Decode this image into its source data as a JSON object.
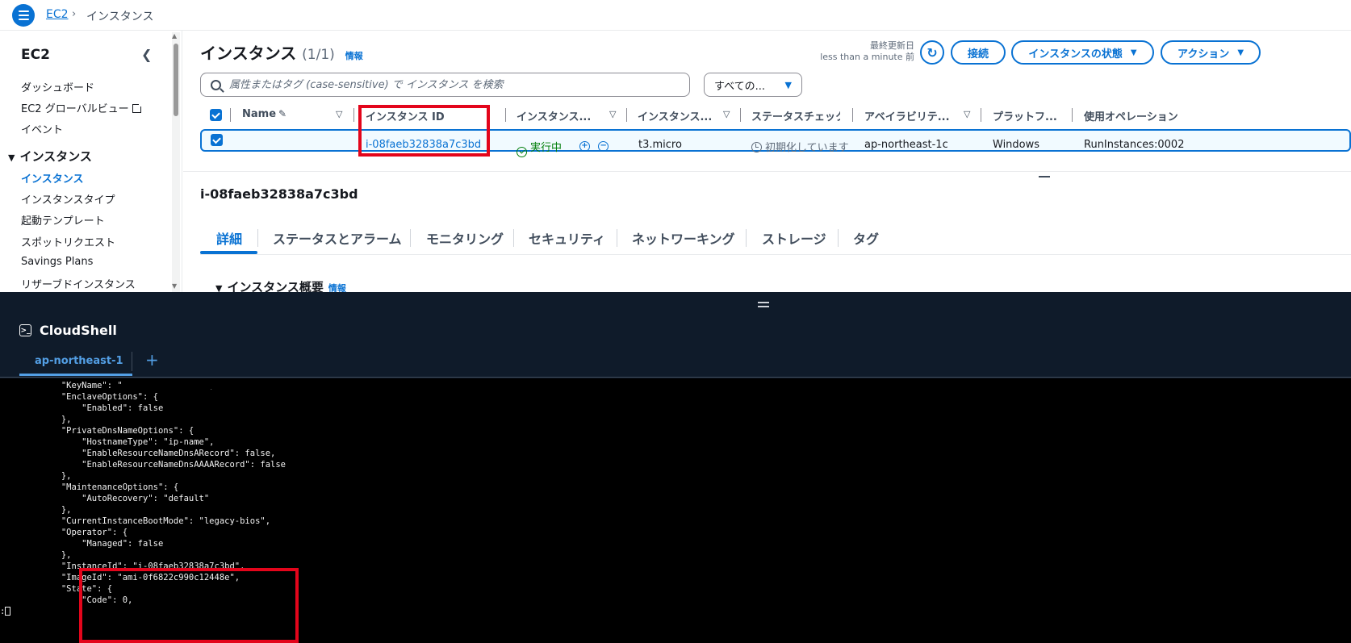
{
  "breadcrumb": {
    "service": "EC2",
    "separator": "›",
    "current": "インスタンス"
  },
  "sidebar": {
    "title": "EC2",
    "items": [
      {
        "label": "ダッシュボード"
      },
      {
        "label": "EC2 グローバルビュー"
      },
      {
        "label": "イベント"
      }
    ],
    "section": {
      "label": "インスタンス",
      "arrow": "▼"
    },
    "section_items": [
      {
        "label": "インスタンス",
        "active": true
      },
      {
        "label": "インスタンスタイプ"
      },
      {
        "label": "起動テンプレート"
      },
      {
        "label": "スポットリクエスト"
      },
      {
        "label": "Savings Plans"
      },
      {
        "label": "リザーブドインスタンス"
      }
    ]
  },
  "header": {
    "title": "インスタンス",
    "count": "(1/1)",
    "info": "情報",
    "last_updated_label": "最終更新日",
    "last_updated_value": "less than a minute 前",
    "connect": "接続",
    "instance_state": "インスタンスの状態",
    "actions": "アクション"
  },
  "search": {
    "placeholder": "属性またはタグ (case-sensitive) で インスタンス を検索"
  },
  "filter": {
    "selected": "すべての..."
  },
  "table": {
    "columns": [
      "Name",
      "インスタンス ID",
      "インスタンス...",
      "インスタンス...",
      "ステータスチェック",
      "アベイラビリテ...",
      "プラットフ...",
      "使用オペレーション"
    ],
    "row": {
      "instance_id": "i-08faeb32838a7c3bd",
      "state": "実行中",
      "type": "t3.micro",
      "status_check": "初期化しています",
      "az": "ap-northeast-1c",
      "platform": "Windows",
      "operation": "RunInstances:0002"
    }
  },
  "detail": {
    "title": "i-08faeb32838a7c3bd",
    "tabs": [
      "詳細",
      "ステータスとアラーム",
      "モニタリング",
      "セキュリティ",
      "ネットワーキング",
      "ストレージ",
      "タグ"
    ],
    "section": "インスタンス概要",
    "section_info": "情報"
  },
  "cloudshell": {
    "title": "CloudShell",
    "tab": "ap-northeast-1",
    "add": "+",
    "lines": [
      "            \"KeyName\": \"                \",",
      "            \"EnclaveOptions\": {",
      "                \"Enabled\": false",
      "            },",
      "            \"PrivateDnsNameOptions\": {",
      "                \"HostnameType\": \"ip-name\",",
      "                \"EnableResourceNameDnsARecord\": false,",
      "                \"EnableResourceNameDnsAAAARecord\": false",
      "            },",
      "            \"MaintenanceOptions\": {",
      "                \"AutoRecovery\": \"default\"",
      "            },",
      "            \"CurrentInstanceBootMode\": \"legacy-bios\",",
      "            \"Operator\": {",
      "                \"Managed\": false",
      "            },",
      "            \"InstanceId\": \"i-08faeb32838a7c3bd\",",
      "            \"ImageId\": \"ami-0f6822c990c12448e\",",
      "            \"State\": {",
      "                \"Code\": 0,"
    ],
    "prompt": ":"
  }
}
